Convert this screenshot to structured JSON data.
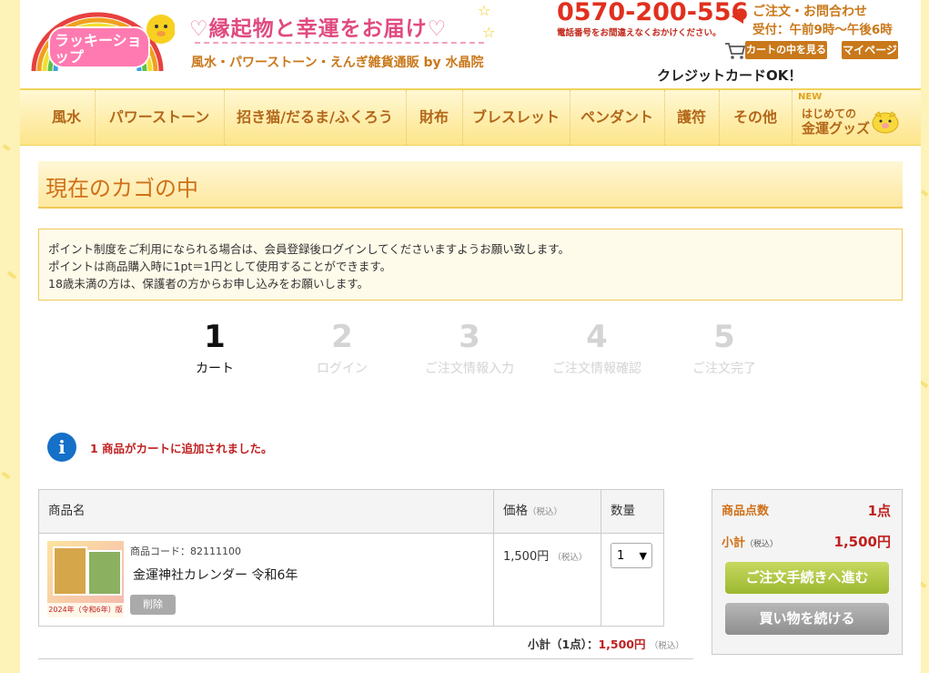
{
  "header": {
    "logo_text": "ラッキーショップ",
    "tagline_title": "縁起物と幸運をお届け",
    "tagline_sub": "風水・パワーストーン・えんぎ雑貨通販 by 水晶院",
    "phone": "0570-200-556",
    "phone_note": "電話番号をお間違えなくおかけください。",
    "contact_line1": "ご注文・お問合わせ",
    "contact_line2": "受付：午前9時～午後6時",
    "cart_button": "カートの中を見る",
    "mypage_button": "マイページ",
    "credit": "クレジットカードOK！"
  },
  "nav": {
    "items": [
      "風水",
      "パワーストーン",
      "招き猫/だるま/ふくろう",
      "財布",
      "ブレスレット",
      "ペンダント",
      "護符",
      "その他"
    ],
    "special_new": "NEW",
    "special_line1": "はじめての",
    "special_line2": "金運グッズ"
  },
  "main": {
    "heading": "現在のカゴの中",
    "notice": [
      "ポイント制度をご利用になられる場合は、会員登録後ログインしてくださいますようお願い致します。",
      "ポイントは商品購入時に1pt＝1円として使用することができます。",
      "18歳未満の方は、保護者の方からお申し込みをお願いします。"
    ],
    "steps": [
      {
        "num": "1",
        "label": "カート"
      },
      {
        "num": "2",
        "label": "ログイン"
      },
      {
        "num": "3",
        "label": "ご注文情報入力"
      },
      {
        "num": "4",
        "label": "ご注文情報確認"
      },
      {
        "num": "5",
        "label": "ご注文完了"
      }
    ],
    "info_message": "1 商品がカートに追加されました。"
  },
  "cart": {
    "headers": {
      "name": "商品名",
      "price": "価格",
      "tax_note": "（税込）",
      "qty": "数量"
    },
    "item": {
      "image_caption": "2024年（令和6年）版",
      "code": "商品コード：82111100",
      "name": "金運神社カレンダー 令和6年",
      "delete": "削除",
      "price": "1,500円",
      "price_tax": "（税込）",
      "qty": "1"
    },
    "subtotal_label": "小計（1点）：",
    "subtotal_amount": "1,500円",
    "subtotal_tax": "（税込）"
  },
  "summary": {
    "count_label": "商品点数",
    "count_value": "1点",
    "subtotal_label": "小計",
    "subtotal_tax": "（税込）",
    "subtotal_value": "1,500円",
    "checkout_button": "ご注文手続きへ進む",
    "continue_button": "買い物を続ける"
  }
}
